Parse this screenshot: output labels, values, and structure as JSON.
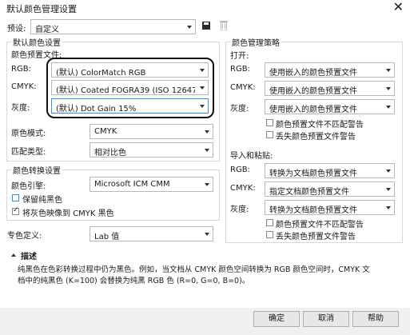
{
  "window": {
    "title": "默认颜色管理设置",
    "close_glyph": "✕"
  },
  "preset": {
    "label": "预设:",
    "value": "自定义",
    "save_icon": "save-icon",
    "delete_icon": "trash-icon"
  },
  "default_color": {
    "group_title": "默认颜色设置",
    "subtitle": "颜色预置文件:",
    "rows": [
      {
        "label": "RGB:",
        "value": "(默认)  ColorMatch RGB"
      },
      {
        "label": "CMYK:",
        "value": "(默认)  Coated FOGRA39 (ISO 12647-2:..."
      },
      {
        "label": "灰度:",
        "value": "(默认)  Dot Gain 15%"
      }
    ],
    "primary_mode_label": "原色模式:",
    "primary_mode_value": "CMYK",
    "match_type_label": "匹配类型:",
    "match_type_value": "相对比色"
  },
  "conversion": {
    "group_title": "颜色转换设置",
    "engine_label": "颜色引擎:",
    "engine_value": "Microsoft ICM CMM",
    "preserve_black_label": "保留纯黑色",
    "preserve_black_checked": false,
    "gray_to_black_label": "将灰色映像到 CMYK 黑色",
    "gray_to_black_checked": true
  },
  "spot": {
    "label": "专色定义:",
    "value": "Lab 值"
  },
  "policy": {
    "group_title": "颜色管理策略",
    "open_title": "打开:",
    "open_rows": [
      {
        "label": "RGB:",
        "value": "使用嵌入的颜色预置文件"
      },
      {
        "label": "CMYK:",
        "value": "使用嵌入的颜色预置文件"
      },
      {
        "label": "灰度:",
        "value": "使用嵌入的颜色预置文件"
      }
    ],
    "open_mismatch_label": "颜色预置文件不匹配警告",
    "open_missing_label": "丢失颜色预置文件警告",
    "paste_title": "导入和粘贴:",
    "paste_rows": [
      {
        "label": "RGB:",
        "value": "转换为文档颜色预置文件"
      },
      {
        "label": "CMYK:",
        "value": "指定文档颜色预置文件"
      },
      {
        "label": "灰度:",
        "value": "转换为文档颜色预置文件"
      }
    ],
    "paste_mismatch_label": "颜色预置文件不匹配警告",
    "paste_missing_label": "丢失颜色预置文件警告"
  },
  "description": {
    "title": "描述",
    "line1": "纯黑色在色彩转换过程中仍为黑色。例如，当文档从 CMYK 颜色空间转换为 RGB 颜色空间时，CMYK 文",
    "line2": "档中的纯黑色 (K=100) 会替换为纯黑 RGB 色 (R=0, G=0, B=0)。"
  },
  "buttons": {
    "ok": "确定",
    "cancel": "取消",
    "help": "帮助"
  }
}
